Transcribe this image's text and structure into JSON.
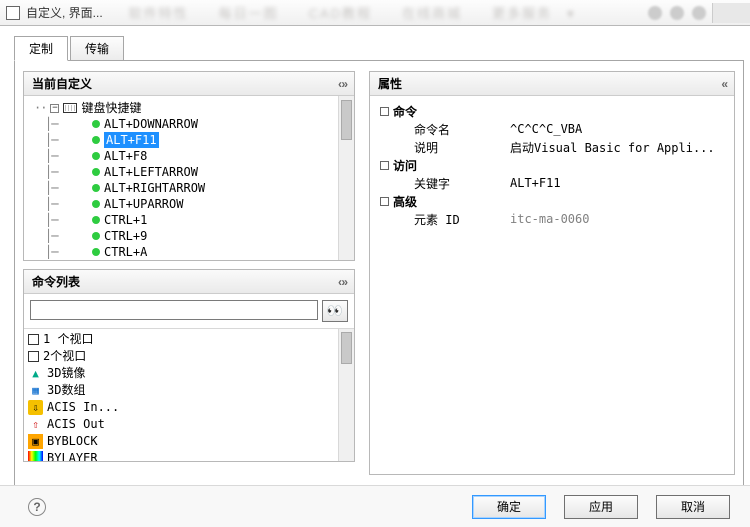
{
  "window": {
    "title": "自定义, 界面..."
  },
  "tabs": {
    "custom": "定制",
    "transfer": "传输"
  },
  "panels": {
    "current": {
      "title": "当前自定义",
      "chev": "‹ »"
    },
    "cmdlist": {
      "title": "命令列表",
      "chev": "‹ »"
    },
    "props": {
      "title": "属性",
      "chev": "«"
    }
  },
  "tree": {
    "root": "键盘快捷键",
    "items": [
      "ALT+DOWNARROW",
      "ALT+F11",
      "ALT+F8",
      "ALT+LEFTARROW",
      "ALT+RIGHTARROW",
      "ALT+UPARROW",
      "CTRL+1",
      "CTRL+9",
      "CTRL+A"
    ],
    "selected_index": 1
  },
  "commands": {
    "search_placeholder": "",
    "items": [
      {
        "icon": "checkbox",
        "label": "1 个视口"
      },
      {
        "icon": "checkbox",
        "label": "2个视口"
      },
      {
        "icon": "mirror3d",
        "label": "3D镜像"
      },
      {
        "icon": "array3d",
        "label": "3D数组"
      },
      {
        "icon": "acis-in",
        "label": "ACIS In..."
      },
      {
        "icon": "acis-out",
        "label": "ACIS Out"
      },
      {
        "icon": "byblock",
        "label": "BYBLOCK"
      },
      {
        "icon": "bylayer",
        "label": "BYLAYER"
      }
    ]
  },
  "props": {
    "g_cmd": "命令",
    "k_name": "命令名",
    "v_name": "^C^C^C_VBA",
    "k_desc": "说明",
    "v_desc": "启动Visual Basic for Appli...",
    "g_acc": "访问",
    "k_key": "关键字",
    "v_key": "ALT+F11",
    "g_adv": "高级",
    "k_elem": "元素 ID",
    "v_elem": "itc-ma-0060"
  },
  "footer": {
    "ok": "确定",
    "apply": "应用",
    "cancel": "取消"
  }
}
